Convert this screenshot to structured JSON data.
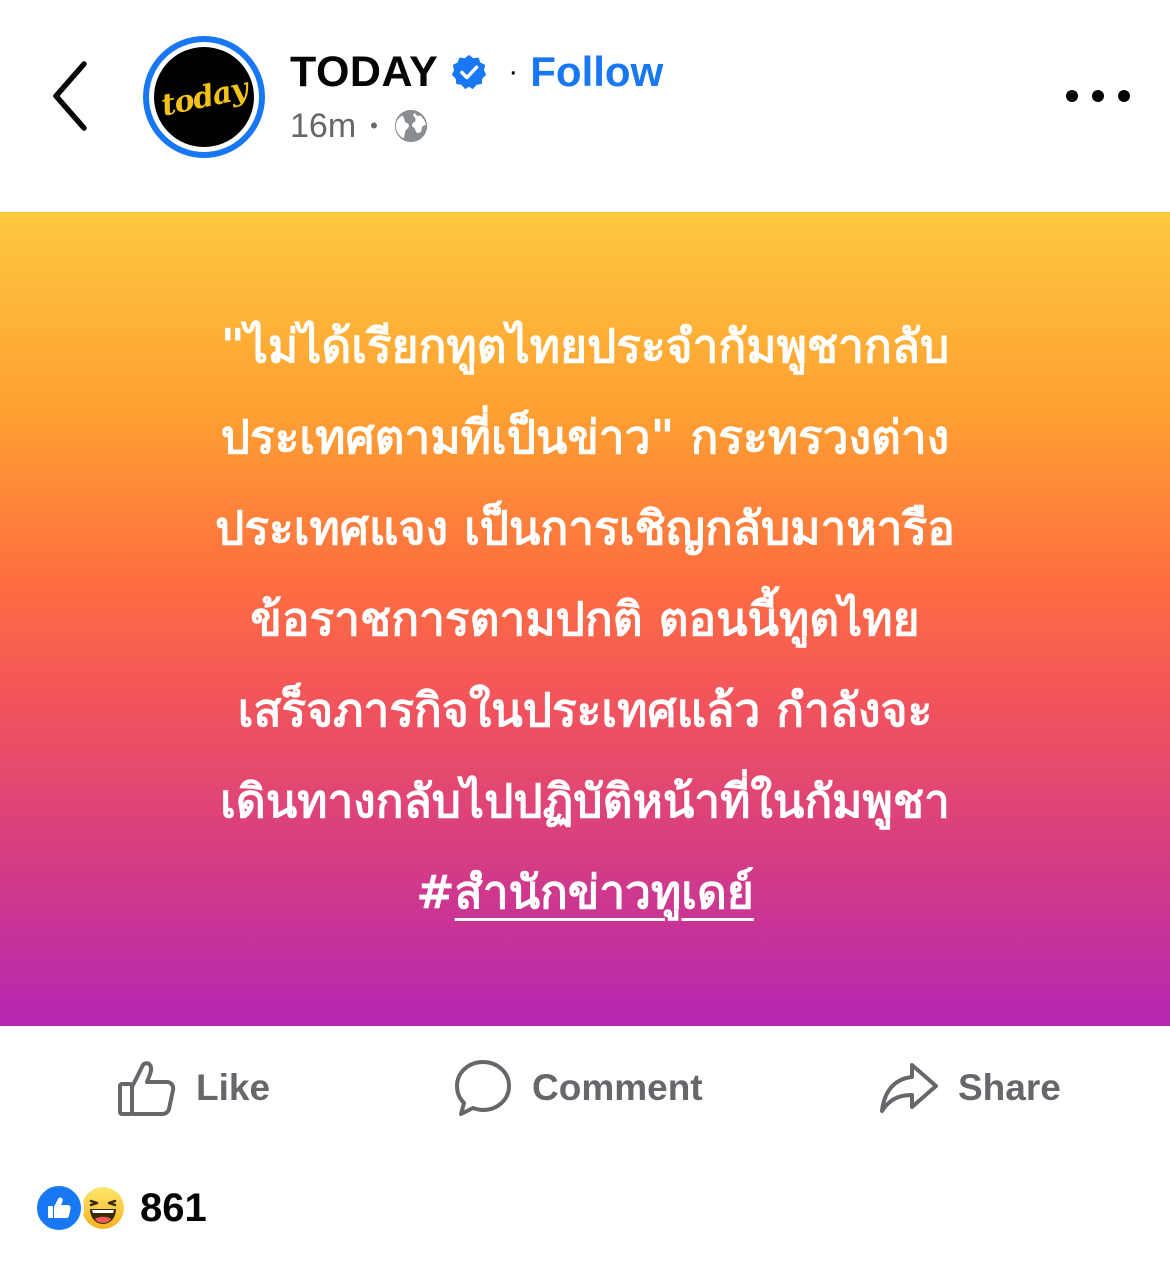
{
  "header": {
    "page_name": "TODAY",
    "avatar_text": "today",
    "separator": "·",
    "follow_label": "Follow",
    "timestamp": "16m",
    "meta_separator": "•",
    "back_icon": "chevron-left-icon",
    "verified_icon": "verified-badge-icon",
    "privacy_icon": "globe-icon",
    "more_icon": "more-horizontal-icon"
  },
  "post": {
    "lines": [
      "\"ไม่ได้เรียกทูตไทยประจำกัมพูชากลับ",
      "ประเทศตามที่เป็นข่าว\" กระทรวงต่าง",
      "ประเทศแจง เป็นการเชิญกลับมาหารือ",
      "ข้อราชการตามปกติ ตอนนี้ทูตไทย",
      "เสร็จภารกิจในประเทศแล้ว กำลังจะ",
      "เดินทางกลับไปปฏิบัติหน้าที่ในกัมพูชา"
    ],
    "hashtag_symbol": "#",
    "hashtag_text": "สำนักข่าวทูเดย์",
    "gradient_colors": [
      "#fdc83e",
      "#fe9f32",
      "#fe6f40",
      "#f2545b",
      "#d43c85",
      "#b526b3"
    ]
  },
  "actions": {
    "like_label": "Like",
    "comment_label": "Comment",
    "share_label": "Share",
    "like_icon": "thumbs-up-icon",
    "comment_icon": "comment-bubble-icon",
    "share_icon": "share-arrow-icon"
  },
  "reactions": {
    "count": "861",
    "types": [
      "like",
      "haha"
    ]
  },
  "colors": {
    "accent": "#1877f2",
    "secondary_text": "#65676b",
    "primary_text": "#050505",
    "avatar_logo": "#f2c21b"
  }
}
